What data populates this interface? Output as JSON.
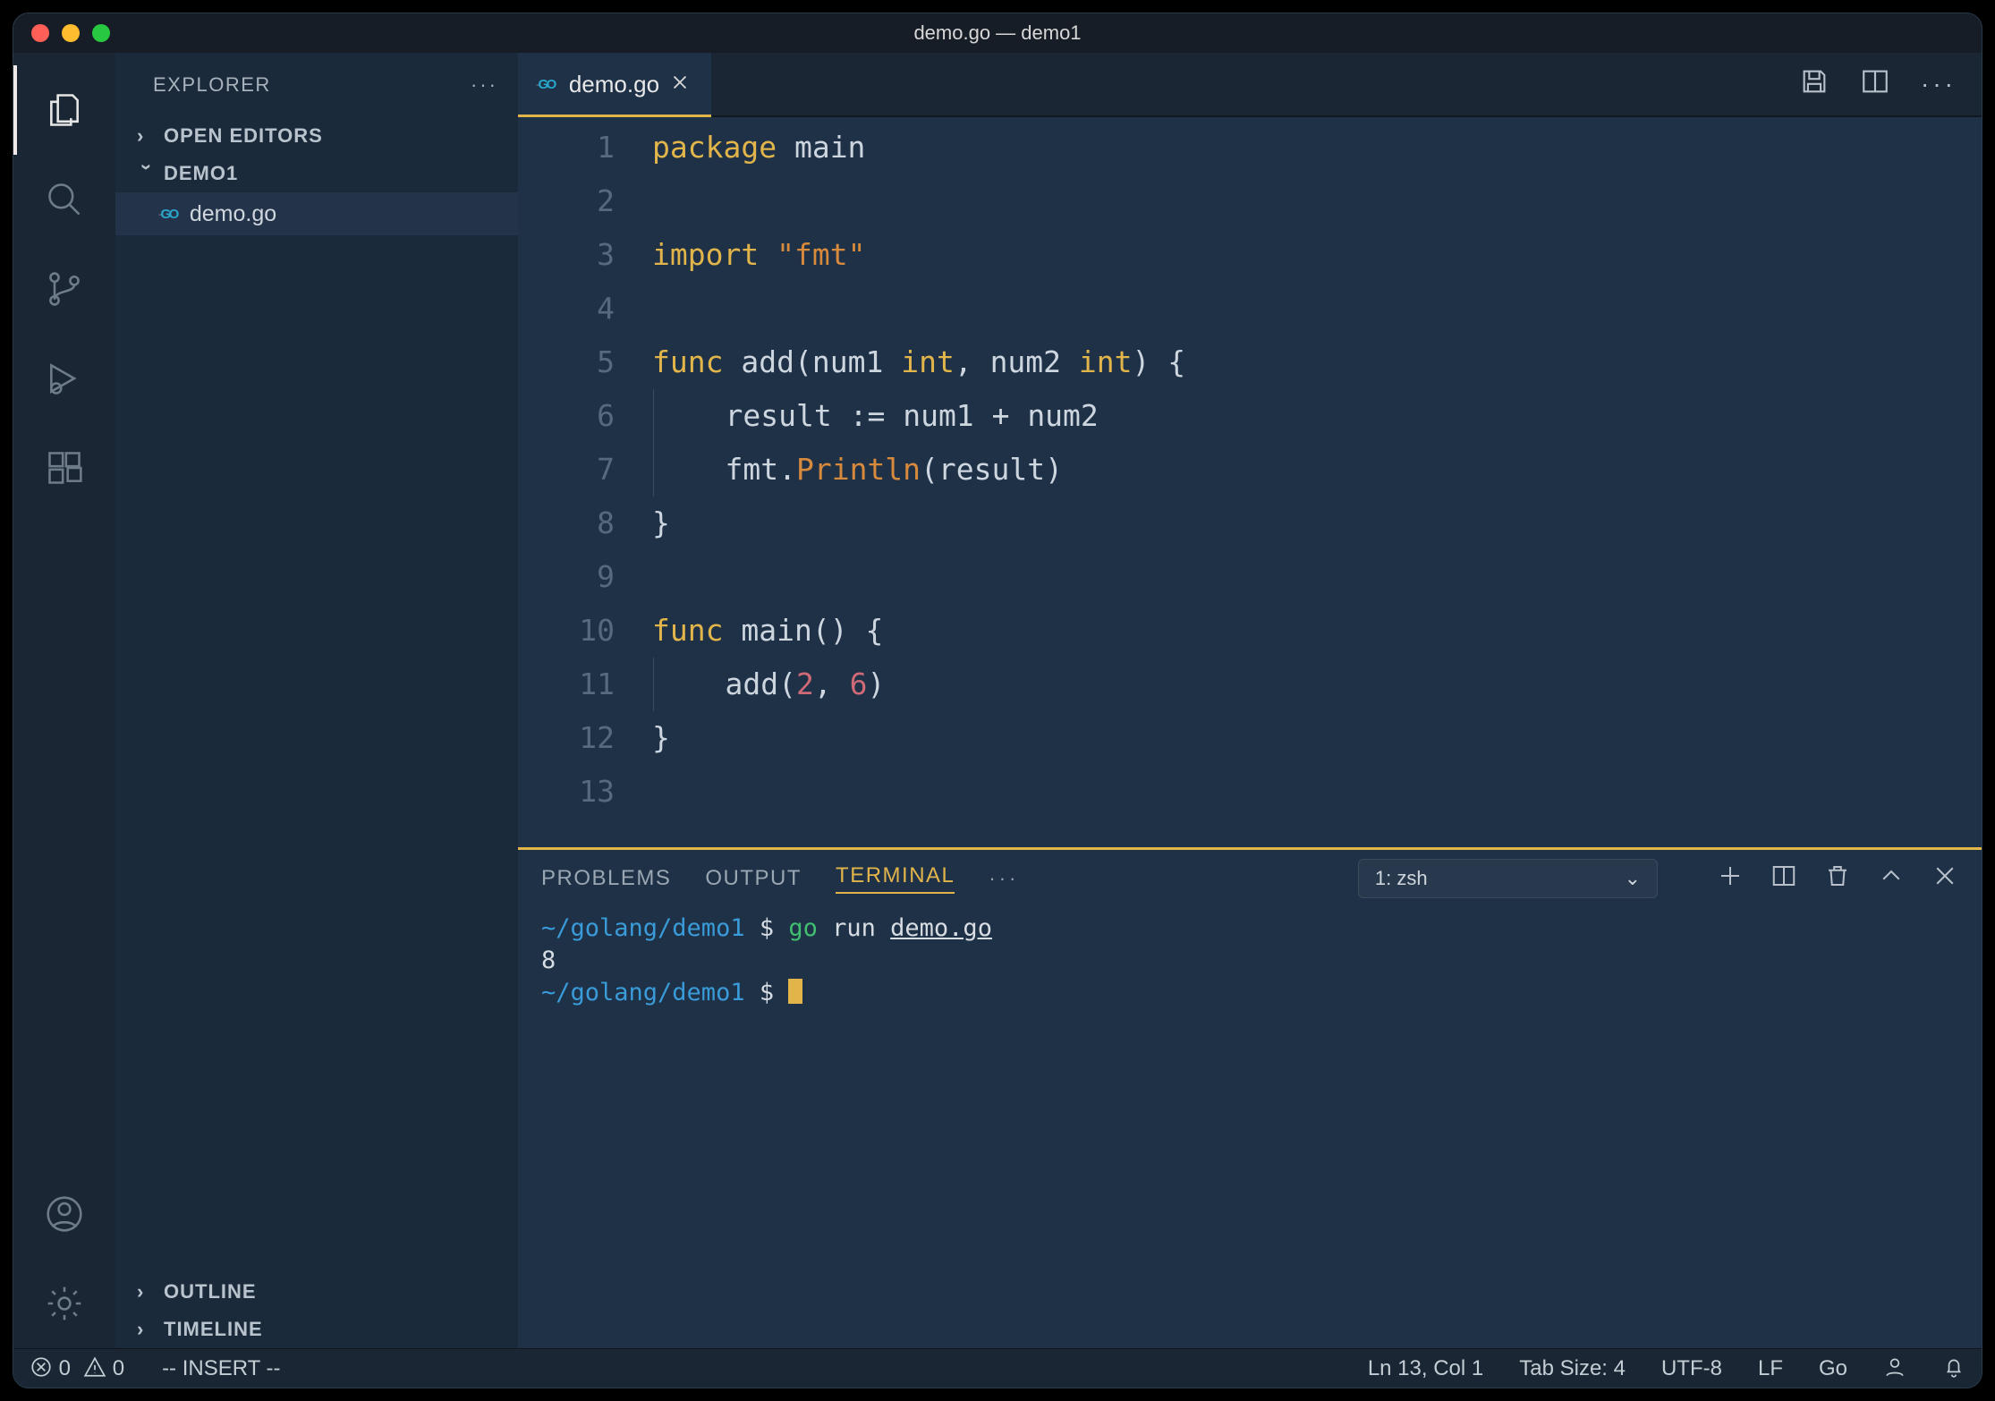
{
  "window": {
    "title": "demo.go — demo1"
  },
  "activitybar": {
    "items": [
      {
        "name": "explorer-icon"
      },
      {
        "name": "search-icon"
      },
      {
        "name": "source-control-icon"
      },
      {
        "name": "run-debug-icon"
      },
      {
        "name": "extensions-icon"
      }
    ],
    "bottom": [
      {
        "name": "accounts-icon"
      },
      {
        "name": "settings-gear-icon"
      }
    ]
  },
  "sidebar": {
    "title": "EXPLORER",
    "open_editors_label": "OPEN EDITORS",
    "folder_label": "DEMO1",
    "files": [
      {
        "name": "demo.go"
      }
    ],
    "outline_label": "OUTLINE",
    "timeline_label": "TIMELINE"
  },
  "tabs": {
    "items": [
      {
        "label": "demo.go",
        "lang_badge": "GO"
      }
    ]
  },
  "editor": {
    "lines": [
      {
        "n": 1,
        "tokens": [
          [
            "kw",
            "package"
          ],
          [
            "sp",
            " "
          ],
          [
            "ident",
            "main"
          ]
        ]
      },
      {
        "n": 2,
        "tokens": []
      },
      {
        "n": 3,
        "tokens": [
          [
            "kw",
            "import"
          ],
          [
            "sp",
            " "
          ],
          [
            "str",
            "\"fmt\""
          ]
        ]
      },
      {
        "n": 4,
        "tokens": []
      },
      {
        "n": 5,
        "tokens": [
          [
            "kw",
            "func"
          ],
          [
            "sp",
            " "
          ],
          [
            "ident",
            "add"
          ],
          [
            "punc",
            "("
          ],
          [
            "ident",
            "num1"
          ],
          [
            "sp",
            " "
          ],
          [
            "type",
            "int"
          ],
          [
            "punc",
            ","
          ],
          [
            "sp",
            " "
          ],
          [
            "ident",
            "num2"
          ],
          [
            "sp",
            " "
          ],
          [
            "type",
            "int"
          ],
          [
            "punc",
            ")"
          ],
          [
            "sp",
            " "
          ],
          [
            "punc",
            "{"
          ]
        ]
      },
      {
        "n": 6,
        "tokens": [
          [
            "guide",
            ""
          ],
          [
            "sp",
            "    "
          ],
          [
            "ident",
            "result"
          ],
          [
            "sp",
            " "
          ],
          [
            "punc",
            ":="
          ],
          [
            "sp",
            " "
          ],
          [
            "ident",
            "num1"
          ],
          [
            "sp",
            " "
          ],
          [
            "punc",
            "+"
          ],
          [
            "sp",
            " "
          ],
          [
            "ident",
            "num2"
          ]
        ]
      },
      {
        "n": 7,
        "tokens": [
          [
            "guide",
            ""
          ],
          [
            "sp",
            "    "
          ],
          [
            "ident",
            "fmt"
          ],
          [
            "punc",
            "."
          ],
          [
            "fn",
            "Println"
          ],
          [
            "punc",
            "("
          ],
          [
            "ident",
            "result"
          ],
          [
            "punc",
            ")"
          ]
        ]
      },
      {
        "n": 8,
        "tokens": [
          [
            "punc",
            "}"
          ]
        ]
      },
      {
        "n": 9,
        "tokens": []
      },
      {
        "n": 10,
        "tokens": [
          [
            "kw",
            "func"
          ],
          [
            "sp",
            " "
          ],
          [
            "ident",
            "main"
          ],
          [
            "punc",
            "()"
          ],
          [
            "sp",
            " "
          ],
          [
            "punc",
            "{"
          ]
        ]
      },
      {
        "n": 11,
        "tokens": [
          [
            "guide",
            ""
          ],
          [
            "sp",
            "    "
          ],
          [
            "ident",
            "add"
          ],
          [
            "punc",
            "("
          ],
          [
            "num",
            "2"
          ],
          [
            "punc",
            ","
          ],
          [
            "sp",
            " "
          ],
          [
            "num",
            "6"
          ],
          [
            "punc",
            ")"
          ]
        ]
      },
      {
        "n": 12,
        "tokens": [
          [
            "punc",
            "}"
          ]
        ]
      },
      {
        "n": 13,
        "tokens": []
      }
    ]
  },
  "panel": {
    "tabs": {
      "problems": "PROBLEMS",
      "output": "OUTPUT",
      "terminal": "TERMINAL"
    },
    "terminal_selector": "1: zsh",
    "terminal_lines": [
      {
        "segments": [
          [
            "t-path",
            "~/golang/demo1"
          ],
          [
            "t-prompt",
            " $ "
          ],
          [
            "t-cmd",
            "go"
          ],
          [
            "t-arg",
            " run "
          ],
          [
            "t-argu",
            "demo.go"
          ]
        ]
      },
      {
        "segments": [
          [
            "t-arg",
            "8"
          ]
        ]
      },
      {
        "segments": [
          [
            "t-path",
            "~/golang/demo1"
          ],
          [
            "t-prompt",
            " $ "
          ],
          [
            "cursor",
            ""
          ]
        ]
      }
    ]
  },
  "statusbar": {
    "errors": "0",
    "warnings": "0",
    "mode": "-- INSERT --",
    "ln_col": "Ln 13, Col 1",
    "tab_size": "Tab Size: 4",
    "encoding": "UTF-8",
    "eol": "LF",
    "lang": "Go"
  }
}
